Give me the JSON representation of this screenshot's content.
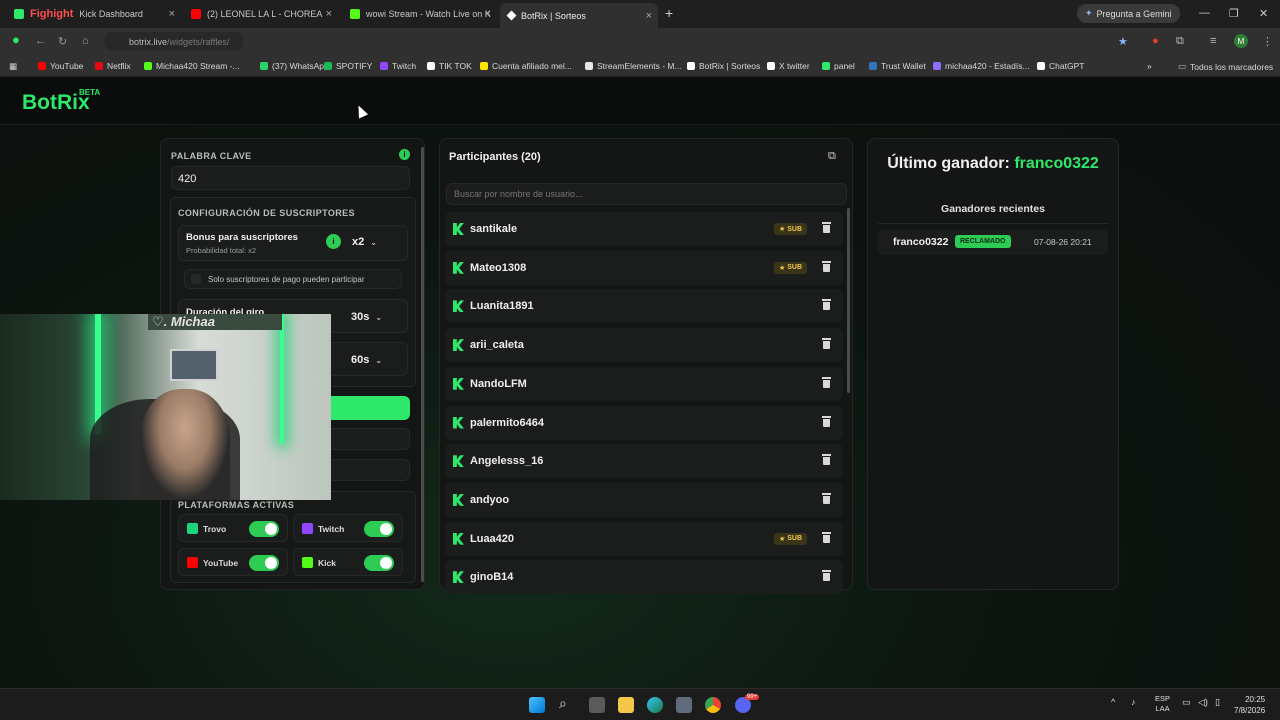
{
  "browser": {
    "tabs": [
      {
        "title": "Kick Dashboard",
        "overlay": "Fighight",
        "color": "#2ee86a"
      },
      {
        "title": "(2) LEONEL LA L - CHOREA",
        "color": "#ff0000"
      },
      {
        "title": "wowi Stream - Watch Live on K",
        "color": "#53fc18"
      },
      {
        "title": "BotRix | Sorteos",
        "color": "#ffffff"
      }
    ],
    "new_tab": "+",
    "gemini": "Pregunta a Gemini",
    "url_host": "botrix.live",
    "url_path": "/widgets/raffles/",
    "profile_initial": "M",
    "bookmarks": [
      {
        "label": "YouTube",
        "color": "#ff0000"
      },
      {
        "label": "Netflix",
        "color": "#e50914"
      },
      {
        "label": "Michaa420 Stream -...",
        "color": "#53fc18"
      },
      {
        "label": "(37) WhatsApp",
        "color": "#25d366"
      },
      {
        "label": "SPOTIFY",
        "color": "#1db954"
      },
      {
        "label": "Twitch",
        "color": "#9146ff"
      },
      {
        "label": "TIK TOK",
        "color": "#ffffff"
      },
      {
        "label": "Cuenta afiliado mel...",
        "color": "#ffe600"
      },
      {
        "label": "StreamElements - M...",
        "color": "#e6e6e6"
      },
      {
        "label": "BotRix | Sorteos",
        "color": "#ffffff"
      },
      {
        "label": "X twitter",
        "color": "#ffffff"
      },
      {
        "label": "panel",
        "color": "#2ee86a"
      },
      {
        "label": "Trust Wallet",
        "color": "#3375bb"
      },
      {
        "label": "michaa420 - Estadís...",
        "color": "#8f6bff"
      },
      {
        "label": "ChatGPT",
        "color": "#ffffff"
      }
    ],
    "all_bookmarks": "Todos los marcadores"
  },
  "app": {
    "logo": "BotRix",
    "beta": "BETA"
  },
  "settings": {
    "keyword_label": "PALABRA CLAVE",
    "keyword_value": "420",
    "subs_config_label": "CONFIGURACIÓN DE SUSCRIPTORES",
    "bonus_title": "Bonus para suscriptores",
    "bonus_sub": "Probabilidad total: x2",
    "bonus_value": "x2",
    "paid_only": "Solo suscriptores de pago pueden participar",
    "spin_label": "Duración del giro",
    "spin_value": "30s",
    "second_value": "60s",
    "platforms_label": "PLATAFORMAS ACTIVAS",
    "platforms": [
      {
        "name": "Trovo",
        "color": "#1ad57c",
        "on": true
      },
      {
        "name": "Twitch",
        "color": "#9146ff",
        "on": true
      },
      {
        "name": "YouTube",
        "color": "#ff0000",
        "on": true
      },
      {
        "name": "Kick",
        "color": "#53fc18",
        "on": true
      }
    ]
  },
  "webcam": {
    "sign": "♡. Michaa"
  },
  "participants": {
    "title": "Participantes (20)",
    "search_placeholder": "Buscar por nombre de usuario...",
    "sub_badge": "SUB",
    "list": [
      {
        "name": "santikale",
        "sub": true
      },
      {
        "name": "Mateo1308",
        "sub": true
      },
      {
        "name": "Luanita1891",
        "sub": false
      },
      {
        "name": "arii_caleta",
        "sub": false
      },
      {
        "name": "NandoLFM",
        "sub": false
      },
      {
        "name": "palermito6464",
        "sub": false
      },
      {
        "name": "Angelesss_16",
        "sub": false
      },
      {
        "name": "andyoo",
        "sub": false
      },
      {
        "name": "Luaa420",
        "sub": true
      },
      {
        "name": "ginoB14",
        "sub": false
      }
    ]
  },
  "winner": {
    "title_prefix": "Último ganador:",
    "name": "franco0322",
    "recent_label": "Ganadores recientes",
    "recent": [
      {
        "name": "franco0322",
        "status": "RECLAMADO",
        "date": "07-08-26 20:21"
      }
    ]
  },
  "taskbar": {
    "lang": "ESP",
    "lang2": "LAA",
    "time": "20:25",
    "date": "7/8/2026",
    "discord_badge": "99+"
  }
}
